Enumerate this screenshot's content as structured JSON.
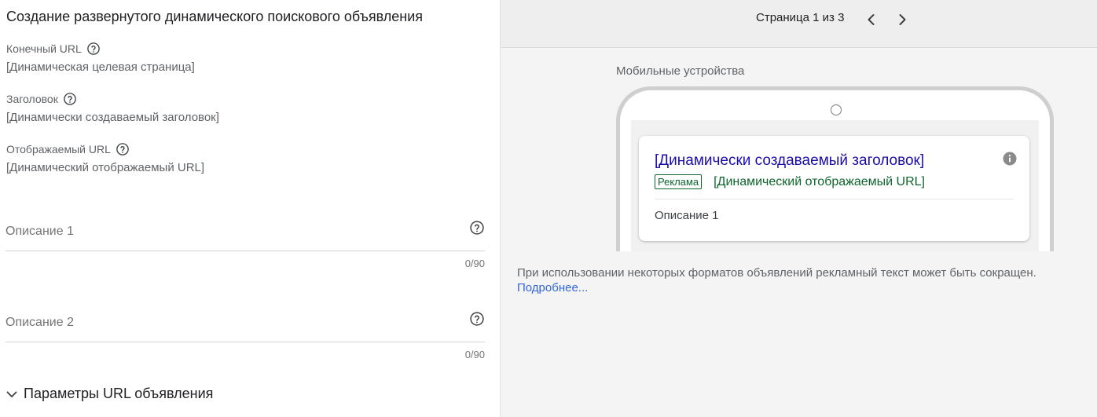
{
  "form": {
    "title": "Создание развернутого динамического поискового объявления",
    "final_url": {
      "label": "Конечный URL",
      "value": "[Динамическая целевая страница]"
    },
    "headline": {
      "label": "Заголовок",
      "value": "[Динамически создаваемый заголовок]"
    },
    "display_url": {
      "label": "Отображаемый URL",
      "value": "[Динамический отображаемый URL]"
    },
    "description1": {
      "placeholder": "Описание 1",
      "counter": "0/90"
    },
    "description2": {
      "placeholder": "Описание 2",
      "counter": "0/90"
    },
    "url_params_label": "Параметры URL объявления"
  },
  "preview": {
    "pager_text": "Страница 1 из 3",
    "device_label": "Мобильные устройства",
    "ad": {
      "headline": "[Динамически создаваемый заголовок]",
      "badge": "Реклама",
      "display_url": "[Динамический отображаемый URL]",
      "description": "Описание 1"
    },
    "note": "При использовании некоторых форматов объявлений рекламный текст может быть сокращен.",
    "learn_more": "Подробнее..."
  },
  "icons": {
    "help": "help-circle-icon",
    "info": "info-icon",
    "prev": "chevron-left-icon",
    "next": "chevron-right-icon",
    "expand": "chevron-down-icon"
  },
  "colors": {
    "ad_headline": "#1a0dab",
    "ad_green": "#0d652d",
    "link": "#3367d6"
  }
}
